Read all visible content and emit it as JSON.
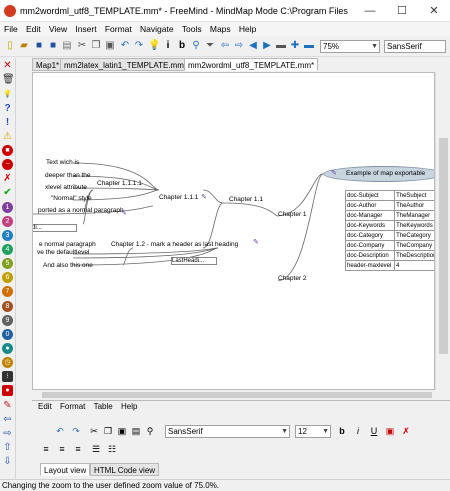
{
  "window": {
    "title": "mm2wordml_utf8_TEMPLATE.mm* - FreeMind - MindMap Mode C:\\Program Files (...",
    "minimize": "—",
    "maximize": "☐",
    "close": "✕"
  },
  "menu": [
    "File",
    "Edit",
    "View",
    "Insert",
    "Format",
    "Navigate",
    "Tools",
    "Maps",
    "Help"
  ],
  "toolbar": {
    "zoom": "75%",
    "font": "SansSerif"
  },
  "tabs": [
    {
      "label": "Map1*"
    },
    {
      "label": "mm2latex_latin1_TEMPLATE.mm*"
    },
    {
      "label": "mm2wordml_utf8_TEMPLATE.mm*"
    }
  ],
  "map": {
    "root": "Example of map exportable",
    "nodes": {
      "ch1": "Chapter 1",
      "ch11": "Chapter 1.1",
      "ch111": "Chapter 1.1.1",
      "ch1111": "Chapter 1.1.1.1",
      "ch12": "Chapter 1.2 - mark a header as last heading",
      "ch2": "Chapter 2",
      "t1": "Text wich is",
      "t2": "deeper than the",
      "t3": "xlevel attribute",
      "t4": "\"Normal\" style",
      "t5": "ported as a normal paragraph",
      "t6": "di...",
      "t7": "e normal paragraph",
      "t8": "ve the defaultlevel",
      "t9": "And also this one",
      "t10": "LastHeadi..."
    },
    "attributes": [
      {
        "key": "doc-Subject",
        "value": "TheSubject"
      },
      {
        "key": "doc-Author",
        "value": "TheAuthor"
      },
      {
        "key": "doc-Manager",
        "value": "TheManager"
      },
      {
        "key": "doc-Keywords",
        "value": "TheKeywords"
      },
      {
        "key": "doc-Category",
        "value": "TheCategory"
      },
      {
        "key": "doc-Company",
        "value": "TheCompany"
      },
      {
        "key": "doc-Description",
        "value": "TheDescription"
      },
      {
        "key": "header-maxlevel",
        "value": "4"
      }
    ]
  },
  "editor": {
    "menu": [
      "Edit",
      "Format",
      "Table",
      "Help"
    ],
    "font": "SansSerif",
    "size": "12",
    "tabs": [
      "Layout view",
      "HTML Code view"
    ]
  },
  "status": "Changing the zoom to the user defined zoom value of 75.0%."
}
